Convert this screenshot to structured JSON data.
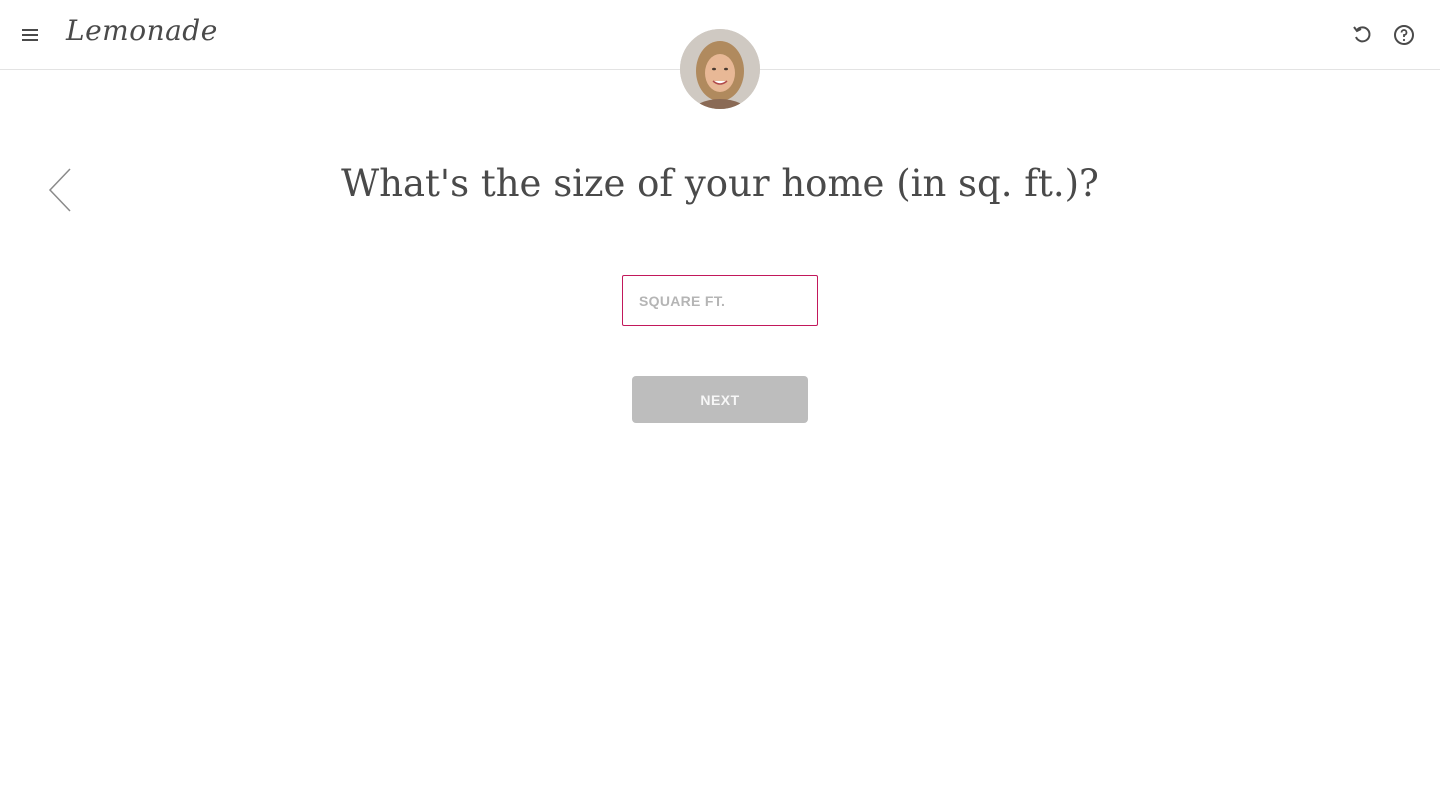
{
  "header": {
    "logo_text": "Lemonade",
    "menu_icon": "hamburger-menu-icon",
    "undo_icon": "undo-icon",
    "help_icon": "help-circle-icon"
  },
  "avatar": {
    "icon": "agent-avatar"
  },
  "navigation": {
    "back_icon": "chevron-left-icon"
  },
  "main": {
    "question": "What's the size of your home (in sq. ft.)?",
    "input_placeholder": "SQUARE FT.",
    "input_value": "",
    "next_label": "NEXT"
  },
  "colors": {
    "accent": "#c2185b",
    "button_disabled": "#bdbdbd",
    "text": "#4a4a4a"
  }
}
